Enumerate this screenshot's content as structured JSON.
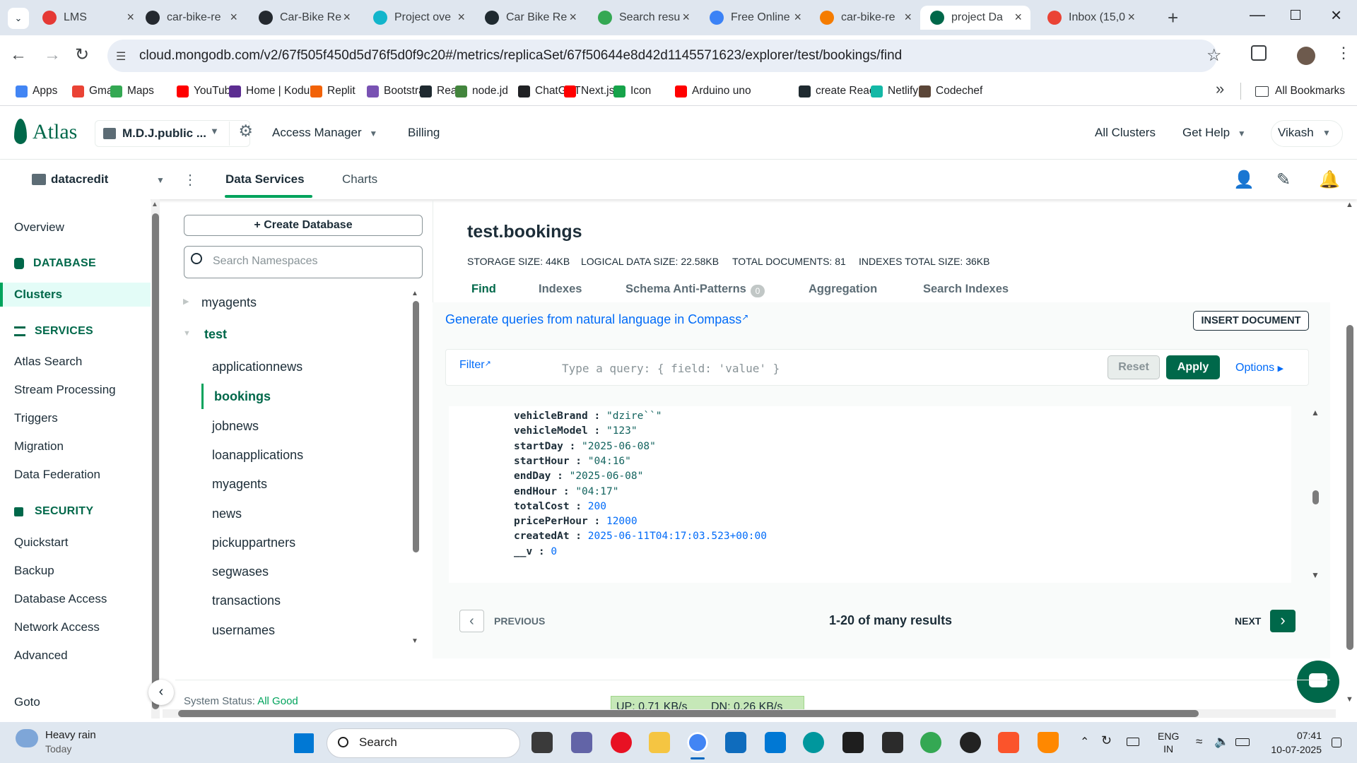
{
  "tabs": [
    {
      "title": "LMS",
      "color": "#e53935"
    },
    {
      "title": "car-bike-re",
      "color": "#24292f"
    },
    {
      "title": "Car-Bike Re",
      "color": "#24292f"
    },
    {
      "title": "Project ove",
      "color": "#12b5cb"
    },
    {
      "title": "Car Bike Re",
      "color": "#1f2a30"
    },
    {
      "title": "Search resu",
      "color": "#34a853"
    },
    {
      "title": "Free Online",
      "color": "#3b82f6"
    },
    {
      "title": "car-bike-re",
      "color": "#f57c00"
    },
    {
      "title": "project Da",
      "color": "#00684a"
    },
    {
      "title": "Inbox (15,0",
      "color": "#ea4335"
    }
  ],
  "url": "cloud.mongodb.com/v2/67f505f450d5d76f5d0f9c20#/metrics/replicaSet/67f50644e8d42d1145571623/explorer/test/bookings/find",
  "bookmarks": [
    {
      "label": "Apps",
      "color": "#4285f4"
    },
    {
      "label": "Gmail",
      "color": "#ea4335"
    },
    {
      "label": "Maps",
      "color": "#34a853"
    },
    {
      "label": "YouTube",
      "color": "#ff0000"
    },
    {
      "label": "Home | Kodular",
      "color": "#5c2d91"
    },
    {
      "label": "Replit",
      "color": "#f26207"
    },
    {
      "label": "Bootstrap",
      "color": "#7952b3"
    },
    {
      "label": "React",
      "color": "#1f2a30"
    },
    {
      "label": "node.jd",
      "color": "#43853d"
    },
    {
      "label": "ChatGPT",
      "color": "#202124"
    },
    {
      "label": "Next.js",
      "color": "#ff0000"
    },
    {
      "label": "Icon",
      "color": "#16a34a"
    },
    {
      "label": "Arduino uno",
      "color": "#ff0000"
    },
    {
      "label": "create React",
      "color": "#1f2a30"
    },
    {
      "label": "Netlify",
      "color": "#14b8a6"
    },
    {
      "label": "Codechef",
      "color": "#5b4638"
    }
  ],
  "all_bookmarks": "All Bookmarks",
  "atlas": {
    "logo": "Atlas",
    "project": "M.D.J.public ...",
    "access_manager": "Access Manager",
    "billing": "Billing",
    "all_clusters": "All Clusters",
    "get_help": "Get Help",
    "user": "Vikash"
  },
  "subbar": {
    "cluster": "datacredit",
    "data_services": "Data Services",
    "charts": "Charts"
  },
  "leftnav": {
    "overview": "Overview",
    "database": "DATABASE",
    "clusters": "Clusters",
    "services": "SERVICES",
    "atlas_search": "Atlas Search",
    "stream": "Stream Processing",
    "triggers": "Triggers",
    "migration": "Migration",
    "federation": "Data Federation",
    "security": "SECURITY",
    "quickstart": "Quickstart",
    "backup": "Backup",
    "db_access": "Database Access",
    "net_access": "Network Access",
    "advanced": "Advanced",
    "goto": "Goto"
  },
  "dbpanel": {
    "create": "+ Create Database",
    "search_placeholder": "Search Namespaces",
    "dbs": [
      "myagents",
      "test"
    ],
    "collections": [
      "applicationnews",
      "bookings",
      "jobnews",
      "loanapplications",
      "myagents",
      "news",
      "pickuppartners",
      "segwases",
      "transactions",
      "usernames"
    ]
  },
  "main": {
    "title": "test.bookings",
    "storage": "STORAGE SIZE: 44KB",
    "logical": "LOGICAL DATA SIZE: 22.58KB",
    "total": "TOTAL DOCUMENTS: 81",
    "indexes_size": "INDEXES TOTAL SIZE: 36KB",
    "tabs": {
      "find": "Find",
      "indexes": "Indexes",
      "schema": "Schema Anti-Patterns",
      "schema_count": "0",
      "aggregation": "Aggregation",
      "search": "Search Indexes"
    },
    "compass_link": "Generate queries from natural language in Compass",
    "insert": "INSERT DOCUMENT",
    "filter": "Filter",
    "query_placeholder": "Type a query: { field: 'value' }",
    "reset": "Reset",
    "apply": "Apply",
    "options": "Options",
    "document": [
      {
        "key": "vehicleBrand",
        "value": "\"dzire``\"",
        "type": "s"
      },
      {
        "key": "vehicleModel",
        "value": "\"123\"",
        "type": "s"
      },
      {
        "key": "startDay",
        "value": "\"2025-06-08\"",
        "type": "s"
      },
      {
        "key": "startHour",
        "value": "\"04:16\"",
        "type": "s"
      },
      {
        "key": "endDay",
        "value": "\"2025-06-08\"",
        "type": "s"
      },
      {
        "key": "endHour",
        "value": "\"04:17\"",
        "type": "s"
      },
      {
        "key": "totalCost",
        "value": "200",
        "type": "n"
      },
      {
        "key": "pricePerHour",
        "value": "12000",
        "type": "n"
      },
      {
        "key": "createdAt",
        "value": "2025-06-11T04:17:03.523+00:00",
        "type": "n"
      },
      {
        "key": "__v",
        "value": "0",
        "type": "n"
      }
    ],
    "previous": "PREVIOUS",
    "results": "1-20 of many results",
    "next": "NEXT"
  },
  "status": {
    "label": "System Status:",
    "value": "All Good"
  },
  "netspeed": {
    "up": "UP: 0.71 KB/s",
    "down": "DN: 0.26 KB/s"
  },
  "taskbar": {
    "weather": "Heavy rain",
    "weather_sub": "Today",
    "search": "Search",
    "lang1": "ENG",
    "lang2": "IN",
    "time": "07:41",
    "date": "10-07-2025"
  }
}
